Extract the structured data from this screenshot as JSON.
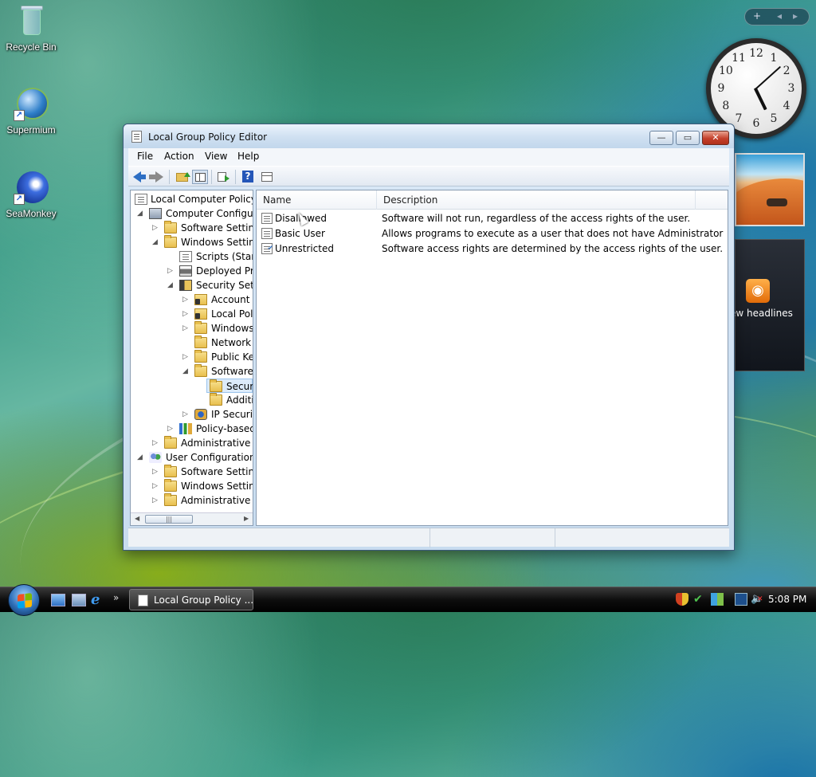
{
  "desktop": {
    "icons": [
      {
        "label": "Recycle Bin"
      },
      {
        "label": "Supermium"
      },
      {
        "label": "SeaMonkey"
      }
    ]
  },
  "sidebar": {
    "controls": {
      "add": "+",
      "prev": "◂",
      "next": "▸"
    },
    "clock": {
      "numbers": [
        "12",
        "1",
        "2",
        "3",
        "4",
        "5",
        "6",
        "7",
        "8",
        "9",
        "10",
        "11"
      ],
      "hour": 5,
      "minute": 8
    },
    "feed_headline": "ew headlines",
    "feed_icon": "rss-icon"
  },
  "window": {
    "title": "Local Group Policy Editor",
    "buttons": {
      "minimize": "—",
      "maximize": "▭",
      "close": "✕"
    },
    "menu": [
      "File",
      "Action",
      "View",
      "Help"
    ],
    "toolbar_icons": [
      "back-arrow-icon",
      "forward-arrow-icon",
      "up-folder-icon",
      "show-hide-tree-icon",
      "export-list-icon",
      "help-icon",
      "extended-view-icon"
    ],
    "tree": [
      {
        "label": "Local Computer Policy"
      },
      {
        "label": "Computer Configura"
      },
      {
        "label": "Software Settings"
      },
      {
        "label": "Windows Setting"
      },
      {
        "label": "Scripts (Startu"
      },
      {
        "label": "Deployed Prir"
      },
      {
        "label": "Security Settin"
      },
      {
        "label": "Account P"
      },
      {
        "label": "Local Poli"
      },
      {
        "label": "Windows"
      },
      {
        "label": "Network L"
      },
      {
        "label": "Public Key"
      },
      {
        "label": "Software F"
      },
      {
        "label": "Securi"
      },
      {
        "label": "Additi"
      },
      {
        "label": "IP Security"
      },
      {
        "label": "Policy-based"
      },
      {
        "label": "Administrative Te"
      },
      {
        "label": "User Configuration"
      },
      {
        "label": "Software Settings"
      },
      {
        "label": "Windows Setting"
      },
      {
        "label": "Administrative Te"
      }
    ],
    "list": {
      "columns": [
        "Name",
        "Description"
      ],
      "rows": [
        {
          "name": "Disallowed",
          "description": "Software will not run, regardless of the access rights of the user."
        },
        {
          "name": "Basic User",
          "description": "Allows programs to execute as a user that does not have Administrator ..."
        },
        {
          "name": "Unrestricted",
          "description": "Software access rights are determined by the access rights of the user."
        }
      ]
    }
  },
  "taskbar": {
    "active_task": "Local Group Policy ...",
    "time": "5:08 PM",
    "quicklaunch_more": "»"
  }
}
